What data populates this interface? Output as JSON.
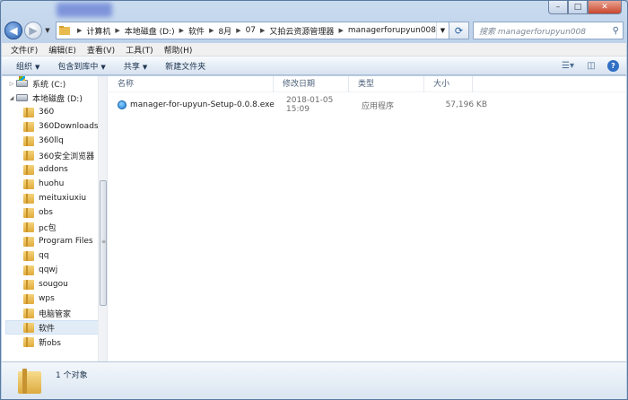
{
  "window": {
    "controls": {
      "minimize": "–",
      "maximize": "□",
      "close": "✕"
    }
  },
  "address_bar": {
    "crumbs": [
      "计算机",
      "本地磁盘 (D:)",
      "软件",
      "8月",
      "07",
      "又拍云资源管理器",
      "managerforupyun008"
    ],
    "search_placeholder": "搜索 managerforupyun008"
  },
  "menu": [
    "文件(F)",
    "编辑(E)",
    "查看(V)",
    "工具(T)",
    "帮助(H)"
  ],
  "commands": [
    {
      "label": "组织",
      "has_dropdown": true
    },
    {
      "label": "包含到库中",
      "has_dropdown": true
    },
    {
      "label": "共享",
      "has_dropdown": true
    },
    {
      "label": "新建文件夹",
      "has_dropdown": false
    }
  ],
  "nav_tree": {
    "drives": [
      {
        "label": "系统 (C:)",
        "icon": "system-drive-icon"
      },
      {
        "label": "本地磁盘 (D:)",
        "icon": "drive-icon"
      }
    ],
    "folders": [
      "360",
      "360Downloads",
      "360llq",
      "360安全浏览器",
      "addons",
      "huohu",
      "meituxiuxiu",
      "obs",
      "pc包",
      "Program Files",
      "qq",
      "qqwj",
      "sougou",
      "wps",
      "电脑管家",
      "软件",
      "新obs"
    ],
    "selected": "软件"
  },
  "columns": [
    "名称",
    "修改日期",
    "类型",
    "大小"
  ],
  "files": [
    {
      "name": "manager-for-upyun-Setup-0.0.8.exe",
      "modified": "2018-01-05 15:09",
      "type": "应用程序",
      "size": "57,196 KB"
    }
  ],
  "status": {
    "count_text": "1 个对象"
  }
}
